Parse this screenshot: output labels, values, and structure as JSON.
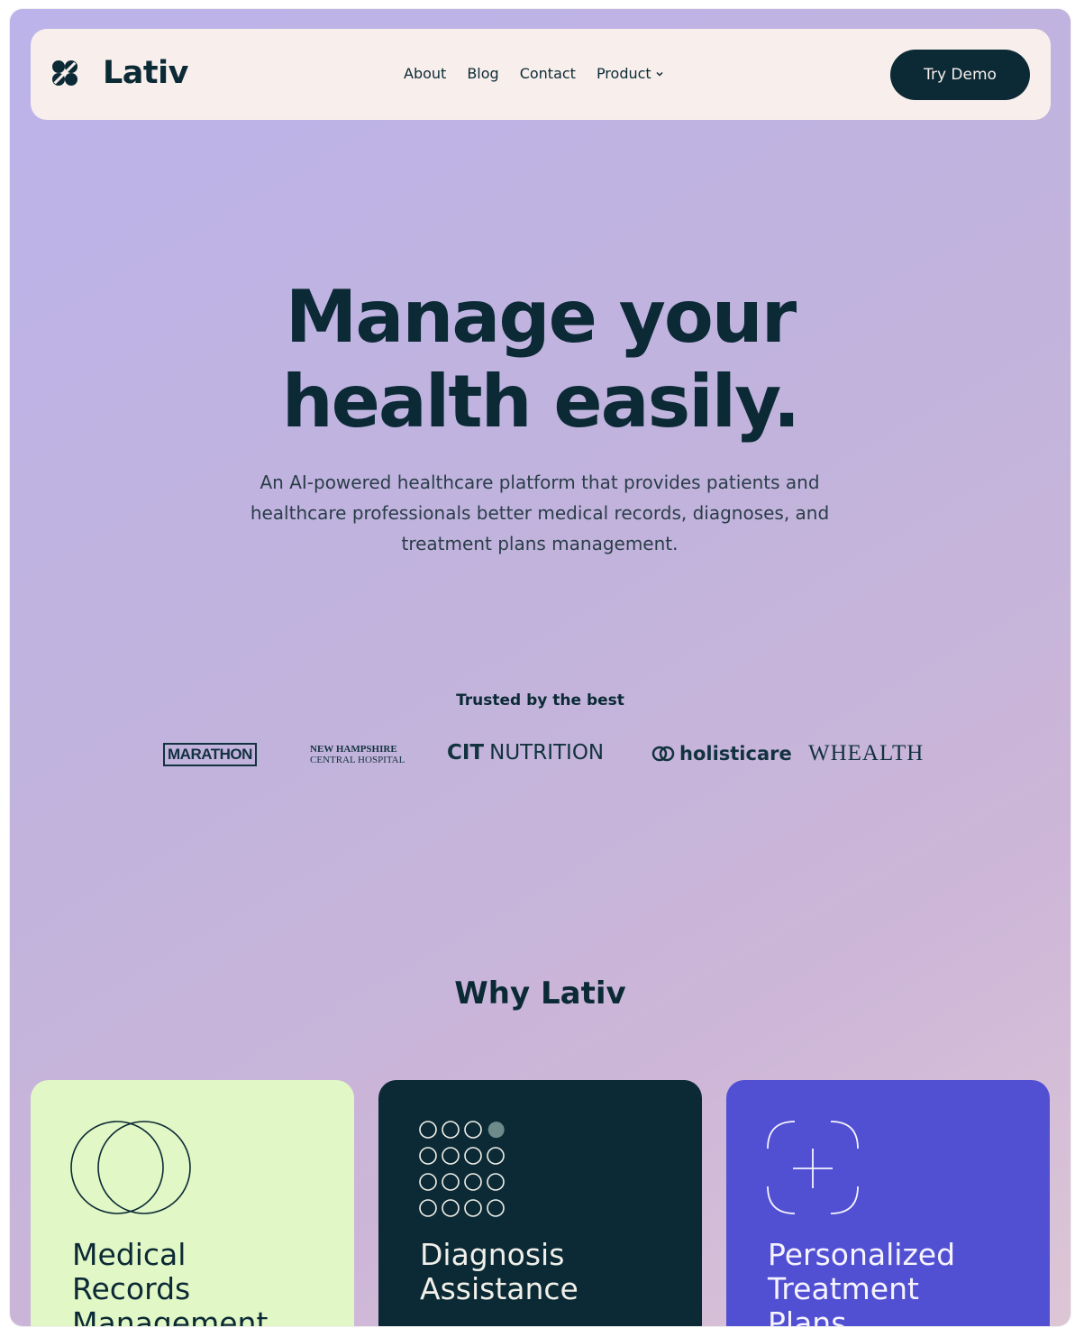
{
  "nav": {
    "brand": "Lativ",
    "links": [
      "About",
      "Blog",
      "Contact",
      "Product"
    ],
    "cta": "Try Demo"
  },
  "hero": {
    "title_line1": "Manage your",
    "title_line2": "health easily.",
    "subtitle_line1": "An AI-powered healthcare platform that provides patients and",
    "subtitle_line2": "healthcare professionals better medical records, diagnoses, and",
    "subtitle_line3": "treatment plans management."
  },
  "trusted": {
    "label": "Trusted by the best",
    "logos": {
      "marathon": "MARATHON",
      "nh_line1": "NEW HAMPSHIRE",
      "nh_line2": "CENTRAL HOSPITAL",
      "cit_bold": "CIT",
      "cit_rest": "NUTRITION",
      "holisticare": "holisticare",
      "wealth": "WHEALTH"
    }
  },
  "why": {
    "title": "Why Lativ",
    "cards": [
      {
        "line1": "Medical",
        "line2": "Records",
        "line3": "Management"
      },
      {
        "line1": "Diagnosis",
        "line2": "Assistance"
      },
      {
        "line1": "Personalized",
        "line2": "Treatment",
        "line3": "Plans"
      }
    ]
  },
  "colors": {
    "primary_dark": "#0b2a35",
    "nav_bg": "#f8efec",
    "card_green": "#e2f7c6",
    "card_purple": "#5250d2"
  }
}
